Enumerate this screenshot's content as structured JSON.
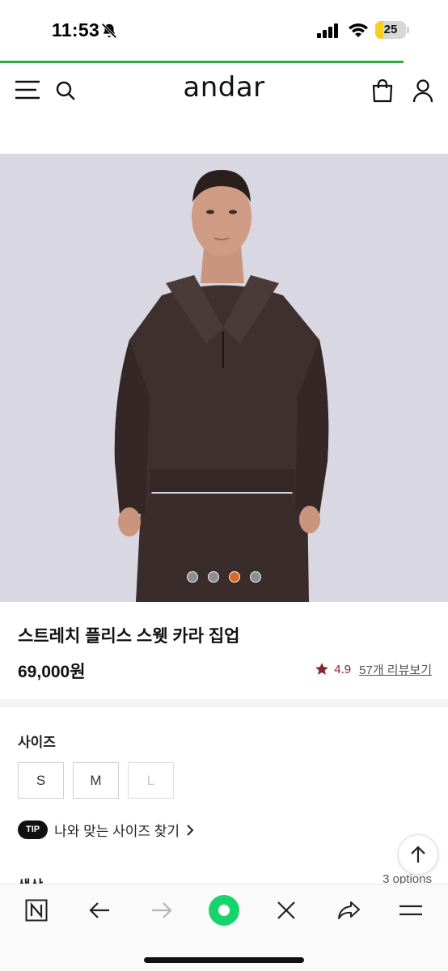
{
  "status_bar": {
    "time": "11:53",
    "battery_level": "25",
    "battery_fraction": 0.25,
    "icons": [
      "bell-slash-icon",
      "cellular-signal-icon",
      "wifi-icon",
      "battery-icon"
    ]
  },
  "load_progress": 0.9,
  "header": {
    "logo": "andar",
    "icons": [
      "menu-icon",
      "search-icon",
      "shopping-bag-icon",
      "user-icon"
    ]
  },
  "gallery": {
    "slide_count": 4,
    "active_index": 2
  },
  "product": {
    "title": "스트레치 플리스 스웻 카라 집업",
    "price": "69,000원",
    "rating": "4.9",
    "review_link": "57개 리뷰보기"
  },
  "size_section": {
    "label": "사이즈",
    "options": [
      {
        "label": "S",
        "available": true
      },
      {
        "label": "M",
        "available": true
      },
      {
        "label": "L",
        "available": false
      }
    ],
    "tip_badge": "TIP",
    "tip_text": "나와 맞는 사이즈 찾기"
  },
  "color_section": {
    "label": "색상",
    "options_count": "3 options"
  },
  "toolbar": {
    "icons": [
      "naver-n-icon",
      "back-arrow-icon",
      "forward-arrow-icon",
      "green-dot-icon",
      "close-icon",
      "share-icon",
      "menu-lines-icon"
    ]
  },
  "colors": {
    "accent_green": "#2eaa3a",
    "rating_red": "#8a2432",
    "active_dot": "#d56a2c",
    "battery_yellow": "#f5d020"
  }
}
